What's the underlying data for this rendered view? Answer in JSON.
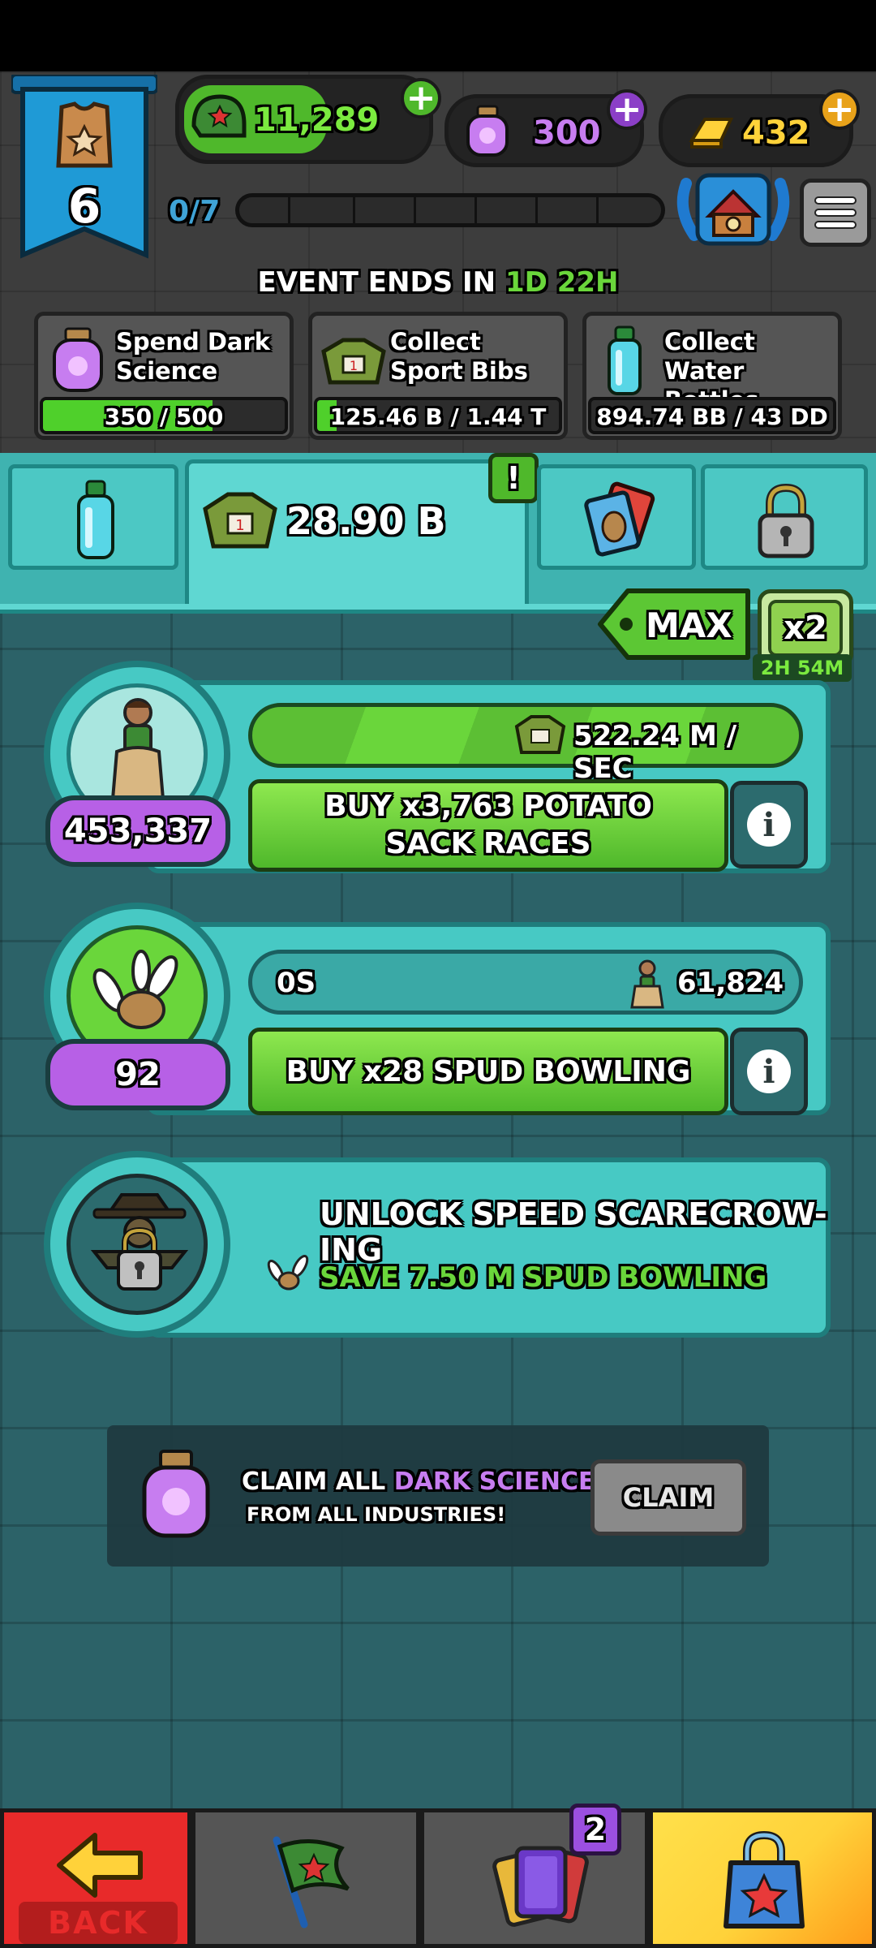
{
  "hud": {
    "level": "6",
    "currency_bibs": "11,289",
    "currency_science": "300",
    "currency_gold": "432",
    "progress_text": "0/7",
    "event_label": "EVENT ENDS IN",
    "event_days": "1D",
    "event_hours": "22H"
  },
  "missions": [
    {
      "label": "Spend Dark Science",
      "progress": "350 / 500",
      "fill": 0.7
    },
    {
      "label": "Collect Sport Bibs",
      "progress": "125.46 B / 1.44 T",
      "fill": 0.08
    },
    {
      "label": "Collect Water Bottles",
      "progress": "894.74 BB / 43 DD",
      "fill": 0.0
    }
  ],
  "tabs": {
    "active_value": "28.90 B",
    "alert": "!"
  },
  "buy_mode": {
    "label": "MAX",
    "multiplier": "x2",
    "timer": "2H 54M"
  },
  "industries": [
    {
      "count": "453,337",
      "rate": "522.24 M / SEC",
      "buy_label": "BUY x3,763 POTATO SACK RACES"
    },
    {
      "count": "92",
      "timer": "0S",
      "requirement": "61,824",
      "buy_label": "BUY x28 SPUD BOWLING"
    }
  ],
  "locked": {
    "title": "UNLOCK SPEED SCARECROW-ING",
    "cost": "SAVE 7.50 M SPUD BOWLING"
  },
  "claim": {
    "text_prefix": "CLAIM ALL ",
    "text_highlight": "DARK SCIENCE",
    "text_line2": "FROM ALL INDUSTRIES!",
    "button": "CLAIM"
  },
  "nav": {
    "back": "BACK",
    "cards_badge": "2"
  },
  "colors": {
    "green": "#6ad63b",
    "purple": "#b760e6",
    "teal": "#47c9c4",
    "gold": "#ffd23a",
    "blue_banner": "#1f9ad6",
    "back_red": "#e82a2a"
  }
}
